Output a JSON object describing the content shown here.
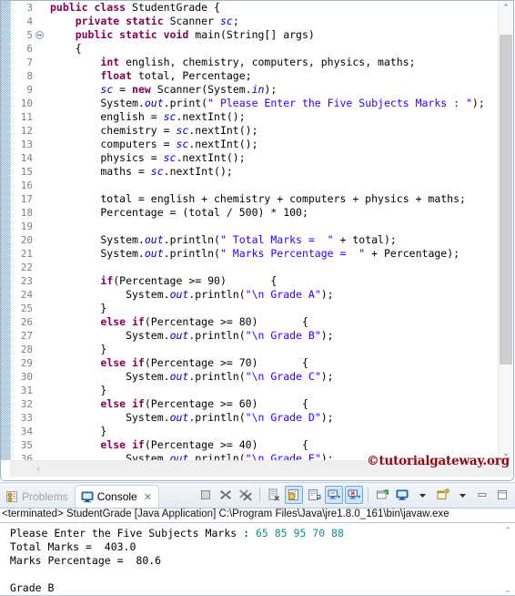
{
  "editor": {
    "first_line_number": 3,
    "fold_line": 5,
    "lines": [
      {
        "n": 3,
        "tokens": [
          {
            "t": "kw",
            "v": "public class "
          },
          {
            "t": "pl",
            "v": "StudentGrade {"
          }
        ]
      },
      {
        "n": 4,
        "tokens": [
          {
            "t": "pl",
            "v": "    "
          },
          {
            "t": "kw",
            "v": "private static "
          },
          {
            "t": "pl",
            "v": "Scanner "
          },
          {
            "t": "fld",
            "v": "sc"
          },
          {
            "t": "pl",
            "v": ";"
          }
        ]
      },
      {
        "n": 5,
        "tokens": [
          {
            "t": "pl",
            "v": "    "
          },
          {
            "t": "kw",
            "v": "public static void "
          },
          {
            "t": "pl",
            "v": "main(String[] args)"
          }
        ]
      },
      {
        "n": 6,
        "tokens": [
          {
            "t": "pl",
            "v": "    {"
          }
        ]
      },
      {
        "n": 7,
        "tokens": [
          {
            "t": "pl",
            "v": "        "
          },
          {
            "t": "kw",
            "v": "int "
          },
          {
            "t": "pl",
            "v": "english, chemistry, computers, physics, maths;"
          }
        ]
      },
      {
        "n": 8,
        "tokens": [
          {
            "t": "pl",
            "v": "        "
          },
          {
            "t": "kw",
            "v": "float "
          },
          {
            "t": "pl",
            "v": "total, Percentage;"
          }
        ]
      },
      {
        "n": 9,
        "tokens": [
          {
            "t": "pl",
            "v": "        "
          },
          {
            "t": "fld",
            "v": "sc"
          },
          {
            "t": "pl",
            "v": " = "
          },
          {
            "t": "kw",
            "v": "new "
          },
          {
            "t": "pl",
            "v": "Scanner(System."
          },
          {
            "t": "fld",
            "v": "in"
          },
          {
            "t": "pl",
            "v": ");"
          }
        ]
      },
      {
        "n": 10,
        "tokens": [
          {
            "t": "pl",
            "v": "        System."
          },
          {
            "t": "fld",
            "v": "out"
          },
          {
            "t": "pl",
            "v": ".print("
          },
          {
            "t": "str",
            "v": "\" Please Enter the Five Subjects Marks : \""
          },
          {
            "t": "pl",
            "v": ");"
          }
        ]
      },
      {
        "n": 11,
        "tokens": [
          {
            "t": "pl",
            "v": "        english = "
          },
          {
            "t": "fld",
            "v": "sc"
          },
          {
            "t": "pl",
            "v": ".nextInt();"
          }
        ]
      },
      {
        "n": 12,
        "tokens": [
          {
            "t": "pl",
            "v": "        chemistry = "
          },
          {
            "t": "fld",
            "v": "sc"
          },
          {
            "t": "pl",
            "v": ".nextInt();"
          }
        ]
      },
      {
        "n": 13,
        "tokens": [
          {
            "t": "pl",
            "v": "        computers = "
          },
          {
            "t": "fld",
            "v": "sc"
          },
          {
            "t": "pl",
            "v": ".nextInt();"
          }
        ]
      },
      {
        "n": 14,
        "tokens": [
          {
            "t": "pl",
            "v": "        physics = "
          },
          {
            "t": "fld",
            "v": "sc"
          },
          {
            "t": "pl",
            "v": ".nextInt();"
          }
        ]
      },
      {
        "n": 15,
        "tokens": [
          {
            "t": "pl",
            "v": "        maths = "
          },
          {
            "t": "fld",
            "v": "sc"
          },
          {
            "t": "pl",
            "v": ".nextInt();"
          }
        ]
      },
      {
        "n": 16,
        "tokens": [
          {
            "t": "pl",
            "v": ""
          }
        ]
      },
      {
        "n": 17,
        "tokens": [
          {
            "t": "pl",
            "v": "        total = english + chemistry + computers + physics + maths;"
          }
        ]
      },
      {
        "n": 18,
        "tokens": [
          {
            "t": "pl",
            "v": "        Percentage = (total / "
          },
          {
            "t": "num",
            "v": "500"
          },
          {
            "t": "pl",
            "v": ") * "
          },
          {
            "t": "num",
            "v": "100"
          },
          {
            "t": "pl",
            "v": ";"
          }
        ]
      },
      {
        "n": 19,
        "tokens": [
          {
            "t": "pl",
            "v": ""
          }
        ]
      },
      {
        "n": 20,
        "tokens": [
          {
            "t": "pl",
            "v": "        System."
          },
          {
            "t": "fld",
            "v": "out"
          },
          {
            "t": "pl",
            "v": ".println("
          },
          {
            "t": "str",
            "v": "\" Total Marks =  \""
          },
          {
            "t": "pl",
            "v": " + total);"
          }
        ]
      },
      {
        "n": 21,
        "tokens": [
          {
            "t": "pl",
            "v": "        System."
          },
          {
            "t": "fld",
            "v": "out"
          },
          {
            "t": "pl",
            "v": ".println("
          },
          {
            "t": "str",
            "v": "\" Marks Percentage =  \""
          },
          {
            "t": "pl",
            "v": " + Percentage);"
          }
        ]
      },
      {
        "n": 22,
        "tokens": [
          {
            "t": "pl",
            "v": ""
          }
        ]
      },
      {
        "n": 23,
        "tokens": [
          {
            "t": "pl",
            "v": "        "
          },
          {
            "t": "kw",
            "v": "if"
          },
          {
            "t": "pl",
            "v": "(Percentage >= "
          },
          {
            "t": "num",
            "v": "90"
          },
          {
            "t": "pl",
            "v": ")       {"
          }
        ]
      },
      {
        "n": 24,
        "tokens": [
          {
            "t": "pl",
            "v": "            System."
          },
          {
            "t": "fld",
            "v": "out"
          },
          {
            "t": "pl",
            "v": ".println("
          },
          {
            "t": "str",
            "v": "\"\\n Grade A\""
          },
          {
            "t": "pl",
            "v": ");"
          }
        ]
      },
      {
        "n": 25,
        "tokens": [
          {
            "t": "pl",
            "v": "        }"
          }
        ]
      },
      {
        "n": 26,
        "tokens": [
          {
            "t": "pl",
            "v": "        "
          },
          {
            "t": "kw",
            "v": "else if"
          },
          {
            "t": "pl",
            "v": "(Percentage >= "
          },
          {
            "t": "num",
            "v": "80"
          },
          {
            "t": "pl",
            "v": ")       {"
          }
        ]
      },
      {
        "n": 27,
        "tokens": [
          {
            "t": "pl",
            "v": "            System."
          },
          {
            "t": "fld",
            "v": "out"
          },
          {
            "t": "pl",
            "v": ".println("
          },
          {
            "t": "str",
            "v": "\"\\n Grade B\""
          },
          {
            "t": "pl",
            "v": ");"
          }
        ]
      },
      {
        "n": 28,
        "tokens": [
          {
            "t": "pl",
            "v": "        }"
          }
        ]
      },
      {
        "n": 29,
        "tokens": [
          {
            "t": "pl",
            "v": "        "
          },
          {
            "t": "kw",
            "v": "else if"
          },
          {
            "t": "pl",
            "v": "(Percentage >= "
          },
          {
            "t": "num",
            "v": "70"
          },
          {
            "t": "pl",
            "v": ")       {"
          }
        ]
      },
      {
        "n": 30,
        "tokens": [
          {
            "t": "pl",
            "v": "            System."
          },
          {
            "t": "fld",
            "v": "out"
          },
          {
            "t": "pl",
            "v": ".println("
          },
          {
            "t": "str",
            "v": "\"\\n Grade C\""
          },
          {
            "t": "pl",
            "v": ");"
          }
        ]
      },
      {
        "n": 31,
        "tokens": [
          {
            "t": "pl",
            "v": "        }"
          }
        ]
      },
      {
        "n": 32,
        "tokens": [
          {
            "t": "pl",
            "v": "        "
          },
          {
            "t": "kw",
            "v": "else if"
          },
          {
            "t": "pl",
            "v": "(Percentage >= "
          },
          {
            "t": "num",
            "v": "60"
          },
          {
            "t": "pl",
            "v": ")       {"
          }
        ]
      },
      {
        "n": 33,
        "tokens": [
          {
            "t": "pl",
            "v": "            System."
          },
          {
            "t": "fld",
            "v": "out"
          },
          {
            "t": "pl",
            "v": ".println("
          },
          {
            "t": "str",
            "v": "\"\\n Grade D\""
          },
          {
            "t": "pl",
            "v": ");"
          }
        ]
      },
      {
        "n": 34,
        "tokens": [
          {
            "t": "pl",
            "v": "        }"
          }
        ]
      },
      {
        "n": 35,
        "tokens": [
          {
            "t": "pl",
            "v": "        "
          },
          {
            "t": "kw",
            "v": "else if"
          },
          {
            "t": "pl",
            "v": "(Percentage >= "
          },
          {
            "t": "num",
            "v": "40"
          },
          {
            "t": "pl",
            "v": ")       {"
          }
        ]
      },
      {
        "n": 36,
        "tokens": [
          {
            "t": "pl",
            "v": "            System."
          },
          {
            "t": "fld",
            "v": "out"
          },
          {
            "t": "pl",
            "v": ".println("
          },
          {
            "t": "str",
            "v": "\"\\n Grade E\""
          },
          {
            "t": "pl",
            "v": ");"
          }
        ]
      }
    ],
    "watermark": "©tutorialgateway.org",
    "scroll_up_glyph": "⌃",
    "scroll_down_glyph": "⌄",
    "hscroll_left_glyph": "‹"
  },
  "console": {
    "tabs": [
      {
        "label": "Problems",
        "active": false,
        "icon": "problems-icon"
      },
      {
        "label": "Console",
        "active": true,
        "icon": "console-icon",
        "close_glyph": "✕"
      }
    ],
    "toolbar": [
      {
        "name": "terminate-button",
        "label": "Terminate",
        "state": "off"
      },
      {
        "name": "remove-launch-button",
        "label": "Remove Launch",
        "state": "off"
      },
      {
        "name": "remove-all-terminated-button",
        "label": "Remove All Terminated Launches",
        "state": "off"
      },
      {
        "name": "clear-console-button",
        "label": "Clear Console",
        "state": "off"
      },
      {
        "name": "scroll-lock-button",
        "label": "Scroll Lock",
        "state": "on"
      },
      {
        "name": "word-wrap-button",
        "label": "Word Wrap",
        "state": "off"
      },
      {
        "name": "show-console-on-output-button",
        "label": "Show Console When Standard Out Changes",
        "state": "on"
      },
      {
        "name": "show-console-on-error-button",
        "label": "Show Console When Standard Error Changes",
        "state": "on"
      },
      {
        "name": "pin-console-button",
        "label": "Pin Console",
        "state": "off"
      },
      {
        "name": "display-selected-console-button",
        "label": "Display Selected Console",
        "state": "off"
      },
      {
        "name": "open-console-button",
        "label": "Open Console",
        "state": "off"
      },
      {
        "name": "minimize-button",
        "label": "Minimize",
        "state": "off"
      },
      {
        "name": "maximize-button",
        "label": "Maximize",
        "state": "off"
      }
    ],
    "terminated_line": "<terminated> StudentGrade [Java Application] C:\\Program Files\\Java\\jre1.8.0_161\\bin\\javaw.exe",
    "output": [
      {
        "prompt": " Please Enter the Five Subjects Marks : ",
        "input": "65 85 95 70 88"
      },
      {
        "prompt": " Total Marks =  403.0",
        "input": ""
      },
      {
        "prompt": " Marks Percentage =  80.6",
        "input": ""
      },
      {
        "prompt": "",
        "input": ""
      },
      {
        "prompt": " Grade B",
        "input": ""
      }
    ],
    "scroll_up_glyph": "⌃",
    "scroll_down_glyph": "⌄"
  },
  "colors": {
    "keyword": "#7f0055",
    "field": "#0000c0",
    "string": "#2a00ff",
    "plain": "#000000",
    "console_input": "#0f8f8f",
    "watermark": "#8b0a16",
    "tab_active_bg": "#ffffff",
    "toolbar_active_bg": "#cfe4f7"
  }
}
